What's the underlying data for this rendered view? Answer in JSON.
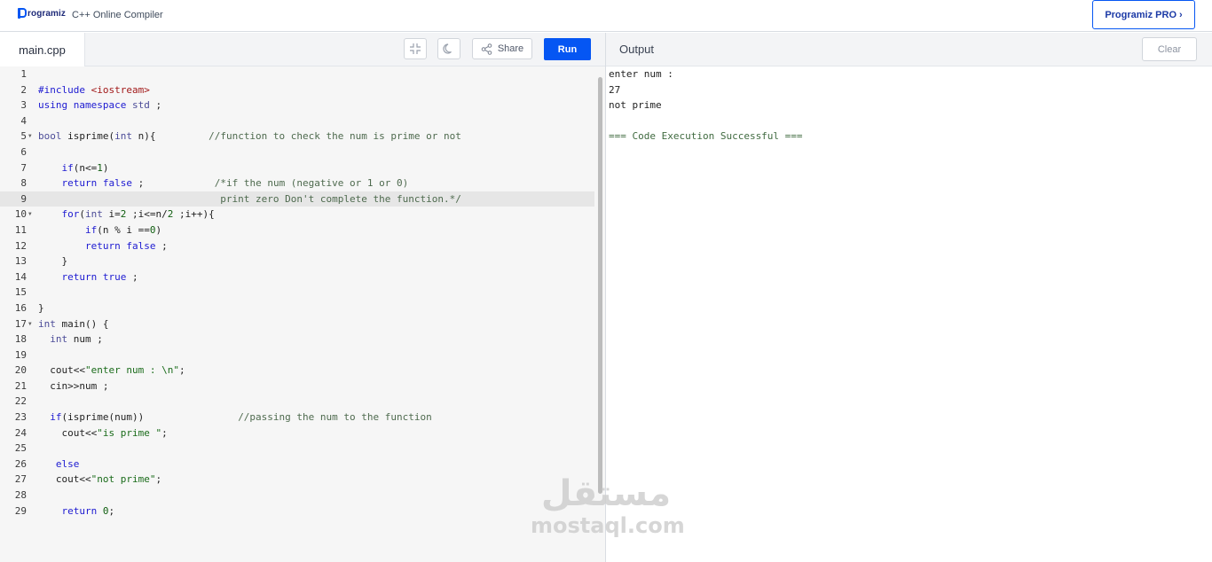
{
  "header": {
    "logo_text": "rogramiz",
    "app_title": "C++ Online Compiler",
    "pro_button": "Programiz PRO",
    "pro_chevron": "›"
  },
  "editor": {
    "file_tab": "main.cpp",
    "share_label": "Share",
    "run_label": "Run",
    "icons": [
      "collapse-icon",
      "dark-mode-icon",
      "share-icon"
    ]
  },
  "output": {
    "title": "Output",
    "clear_label": "Clear",
    "lines": [
      "enter num :",
      "27",
      "not prime",
      "",
      "=== Code Execution Successful ==="
    ]
  },
  "code_lines": [
    {
      "n": "1",
      "t": ""
    },
    {
      "n": "2",
      "t": "#include <iostream>"
    },
    {
      "n": "3",
      "t": "using namespace std ;"
    },
    {
      "n": "4",
      "t": ""
    },
    {
      "n": "5",
      "t": "bool isprime(int n){         //function to check the num is prime or not"
    },
    {
      "n": "6",
      "t": ""
    },
    {
      "n": "7",
      "t": "    if(n<=1)"
    },
    {
      "n": "8",
      "t": "    return false ;            /*if the num (negative or 1 or 0)"
    },
    {
      "n": "9",
      "t": "                               print zero Don't complete the function.*/"
    },
    {
      "n": "10",
      "t": "    for(int i=2 ;i<=n/2 ;i++){"
    },
    {
      "n": "11",
      "t": "        if(n % i ==0)"
    },
    {
      "n": "12",
      "t": "        return false ;"
    },
    {
      "n": "13",
      "t": "    }"
    },
    {
      "n": "14",
      "t": "    return true ;"
    },
    {
      "n": "15",
      "t": ""
    },
    {
      "n": "16",
      "t": "}"
    },
    {
      "n": "17",
      "t": "int main() {"
    },
    {
      "n": "18",
      "t": "  int num ;"
    },
    {
      "n": "19",
      "t": ""
    },
    {
      "n": "20",
      "t": "  cout<<\"enter num : \\n\";"
    },
    {
      "n": "21",
      "t": "  cin>>num ;"
    },
    {
      "n": "22",
      "t": ""
    },
    {
      "n": "23",
      "t": "  if(isprime(num))                //passing the num to the function"
    },
    {
      "n": "24",
      "t": "    cout<<\"is prime \";"
    },
    {
      "n": "25",
      "t": ""
    },
    {
      "n": "26",
      "t": "   else"
    },
    {
      "n": "27",
      "t": "   cout<<\"not prime\";"
    },
    {
      "n": "28",
      "t": ""
    },
    {
      "n": "29",
      "t": "    return 0;"
    }
  ],
  "watermark": {
    "arabic": "مستقل",
    "latin": "mostaql.com"
  }
}
